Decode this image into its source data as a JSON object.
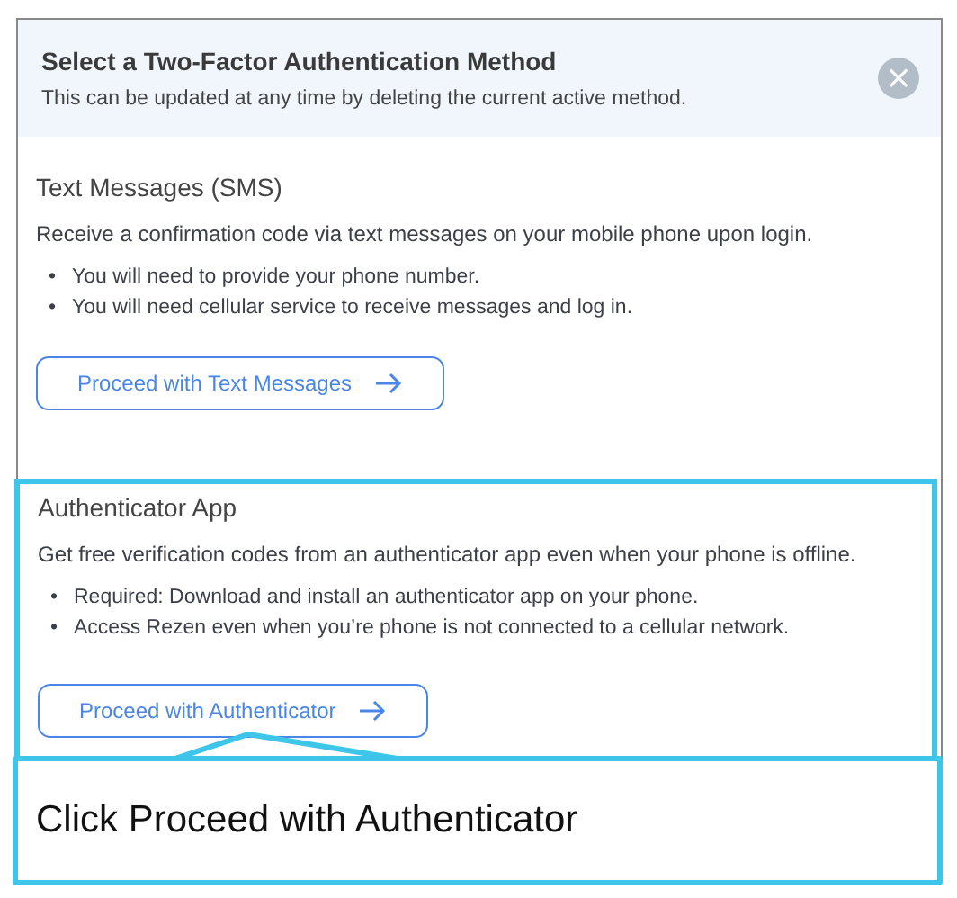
{
  "dialog": {
    "title": "Select a Two-Factor Authentication Method",
    "subtitle": "This can be updated at any time by deleting the current active method.",
    "close": "×",
    "methods": [
      {
        "title": "Text Messages (SMS)",
        "description": "Receive a confirmation code via text messages on your mobile phone upon login.",
        "bullets": [
          {
            "marker": "•",
            "text": "You will need to provide your phone number."
          },
          {
            "marker": "•",
            "text": "You will need cellular service to receive messages and log in."
          }
        ],
        "button": "Proceed with Text Messages",
        "highlighted": false
      },
      {
        "title": "Authenticator App",
        "description": "Get free verification codes from an authenticator app even when your phone is offline.",
        "bullets": [
          {
            "marker": "•",
            "text": "Required: Download and install an authenticator app on your phone."
          },
          {
            "marker": "•",
            "text": "Access Rezen even when you’re phone is not connected to a cellular network."
          }
        ],
        "button": "Proceed with Authenticator",
        "highlighted": true
      }
    ]
  },
  "callout": {
    "text": "Click Proceed with Authenticator"
  }
}
